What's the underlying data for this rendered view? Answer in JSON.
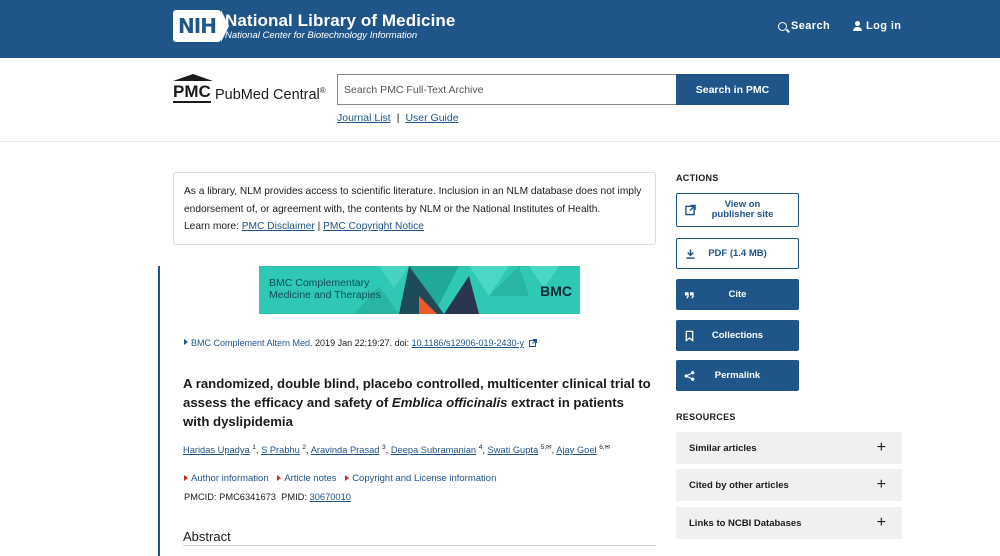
{
  "topbar": {
    "logo_text": "NIH",
    "title": "National Library of Medicine",
    "subtitle": "National Center for Biotechnology Information",
    "search_label": "Search",
    "login_label": "Log in"
  },
  "header": {
    "pmc_mark": "PMC",
    "pmc_name": "PubMed Central",
    "pmc_reg": "®",
    "search_placeholder": "Search PMC Full-Text Archive",
    "search_button": "Search in PMC",
    "links": [
      "Journal List",
      "User Guide"
    ],
    "link_sep": "|"
  },
  "disclaimer": {
    "text": "As a library, NLM provides access to scientific literature. Inclusion in an NLM database does not imply endorsement of, or agreement with, the contents by NLM or the National Institutes of Health.",
    "learn_more": "Learn more: ",
    "link1": "PMC Disclaimer",
    "sep": " | ",
    "link2": "PMC Copyright Notice"
  },
  "banner": {
    "line1": "BMC Complementary",
    "line2": "Medicine and Therapies",
    "brand": "BMC"
  },
  "citation": {
    "journal": "BMC Complement Altern Med.",
    "date": " 2019 Jan 22;19:27. doi: ",
    "doi": "10.1186/s12906-019-2430-y"
  },
  "article": {
    "title_part1": "A randomized, double blind, placebo controlled, multicenter clinical trial to assess the efficacy and safety of ",
    "title_italic": "Emblica officinalis",
    "title_part2": " extract in patients with dyslipidemia",
    "authors": [
      {
        "name": "Haridas Upadya",
        "sup": "1"
      },
      {
        "name": "S Prabhu",
        "sup": "2"
      },
      {
        "name": "Aravinda Prasad",
        "sup": "3"
      },
      {
        "name": "Deepa Subramanian",
        "sup": "4"
      },
      {
        "name": "Swati Gupta",
        "sup": "5,✉"
      },
      {
        "name": "Ajay Goel",
        "sup": "6,✉"
      }
    ],
    "notes": [
      "Author information",
      "Article notes",
      "Copyright and License information"
    ],
    "pmcid_label": "PMCID: PMC6341673",
    "pmid_label": "PMID: ",
    "pmid": "30670010",
    "abstract_heading": "Abstract"
  },
  "actions": {
    "heading": "ACTIONS",
    "view_publisher": "View on publisher site",
    "pdf": "PDF (1.4 MB)",
    "cite": "Cite",
    "collections": "Collections",
    "permalink": "Permalink"
  },
  "resources": {
    "heading": "RESOURCES",
    "items": [
      "Similar articles",
      "Cited by other articles",
      "Links to NCBI Databases"
    ],
    "expand_symbol": "+"
  },
  "colors": {
    "brand_blue": "#20558a",
    "banner_teal": "#2fc8b4",
    "note_red": "#d0241b"
  }
}
